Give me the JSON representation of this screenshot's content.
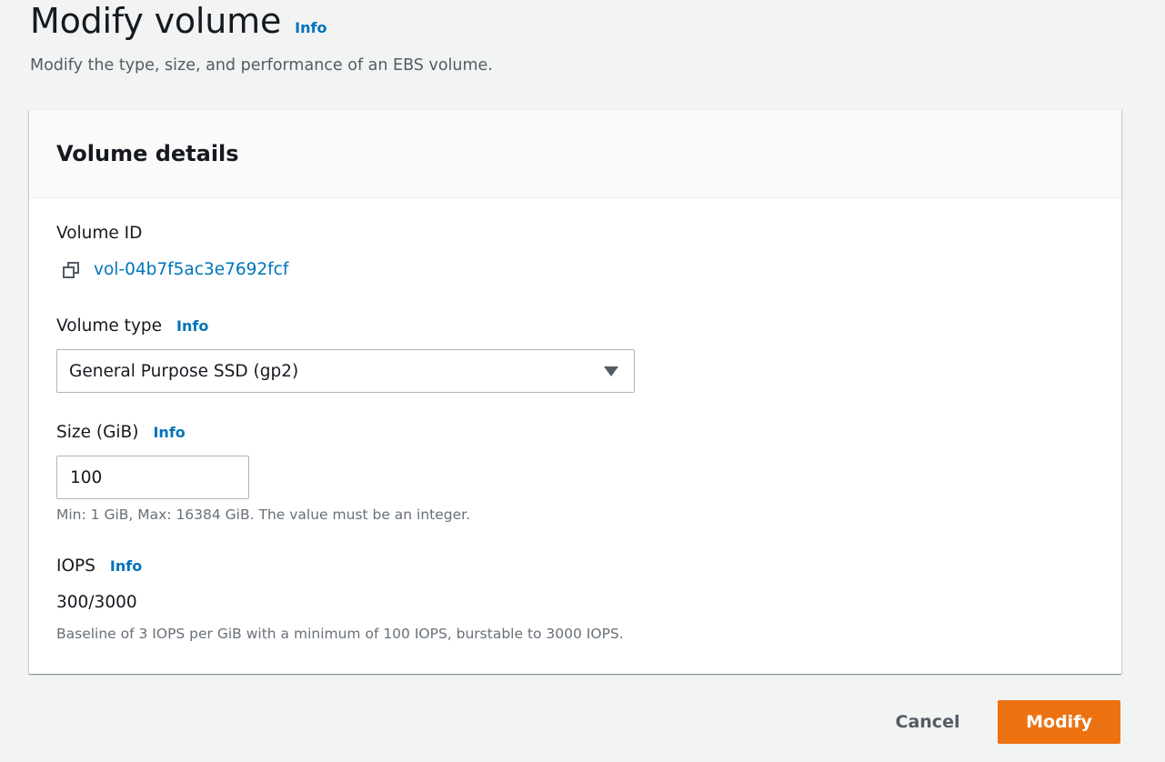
{
  "header": {
    "title": "Modify volume",
    "info": "Info",
    "description": "Modify the type, size, and performance of an EBS volume."
  },
  "volume_details": {
    "title": "Volume details",
    "volume_id": {
      "label": "Volume ID",
      "value": "vol-04b7f5ac3e7692fcf",
      "icon": "copy-icon"
    },
    "volume_type": {
      "label": "Volume type",
      "info": "Info",
      "selected": "General Purpose SSD (gp2)",
      "icon": "caret-down-icon"
    },
    "size": {
      "label": "Size (GiB)",
      "info": "Info",
      "value": "100",
      "hint": "Min: 1 GiB, Max: 16384 GiB. The value must be an integer."
    },
    "iops": {
      "label": "IOPS",
      "info": "Info",
      "value": "300/3000",
      "hint": "Baseline of 3 IOPS per GiB with a minimum of 100 IOPS, burstable to 3000 IOPS."
    }
  },
  "actions": {
    "cancel": "Cancel",
    "modify": "Modify"
  },
  "colors": {
    "link": "#0073bb",
    "primary_button": "#ec7211",
    "background": "#f2f3f3"
  }
}
